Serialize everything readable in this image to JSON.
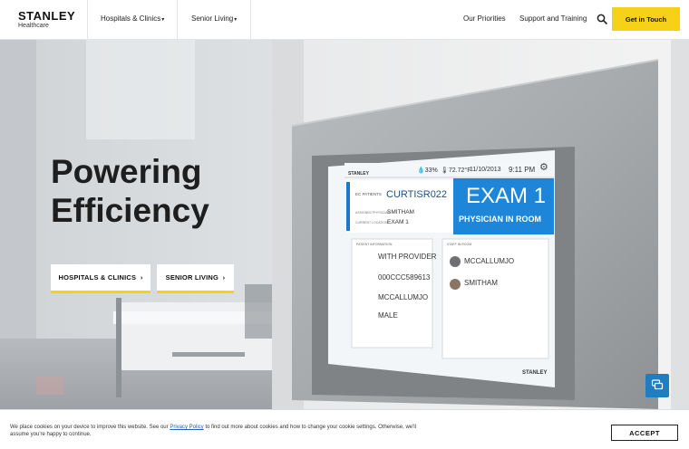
{
  "header": {
    "logo": {
      "main": "STANLEY",
      "sub": "Healthcare"
    },
    "nav_dropdowns": [
      {
        "label": "Hospitals & Clinics"
      },
      {
        "label": "Senior Living"
      }
    ],
    "nav_links": [
      {
        "label": "Our Priorities"
      },
      {
        "label": "Support and Training"
      }
    ],
    "search_icon": "search-icon",
    "cta_label": "Get in Touch",
    "accent_color": "#f7d117"
  },
  "hero": {
    "title_line1": "Powering",
    "title_line2": "Efficiency",
    "buttons": [
      {
        "label": "HOSPITALS & CLINICS"
      },
      {
        "label": "SENIOR LIVING"
      }
    ],
    "screen": {
      "brand": "STANLEY",
      "humidity": "33%",
      "temperature": "72.72°F",
      "date": "11/10/2013",
      "time": "9:11 PM",
      "patients_label": "EC PATIENTS",
      "patient_id": "CURTISR022",
      "physician_label": "ASSIGNED PHYSICIAN",
      "physician": "SMITHAM",
      "location_label": "CURRENT LOCATION",
      "location": "EXAM 1",
      "room_title": "EXAM 1",
      "room_status": "PHYSICIAN IN ROOM",
      "patient_info_header": "PATIENT INFORMATION",
      "staff_header": "STAFF IN ROOM",
      "info_rows": [
        {
          "value": "WITH PROVIDER"
        },
        {
          "value": "000CCC589613"
        },
        {
          "value": "MCCALLUMJO"
        },
        {
          "value": "MALE"
        }
      ],
      "staff": [
        {
          "name": "MCCALLUMJO"
        },
        {
          "name": "SMITHAM"
        }
      ],
      "bottom_brand": "STANLEY"
    },
    "chat_icon": "chat-icon"
  },
  "cookie": {
    "text_before": "We place cookies on your device to improve this website. See our ",
    "link_text": "Privacy Policy",
    "text_after": " to find out more about cookies and how to change your cookie settings. Otherwise, we'll assume you're happy to continue.",
    "accept_label": "ACCEPT"
  }
}
